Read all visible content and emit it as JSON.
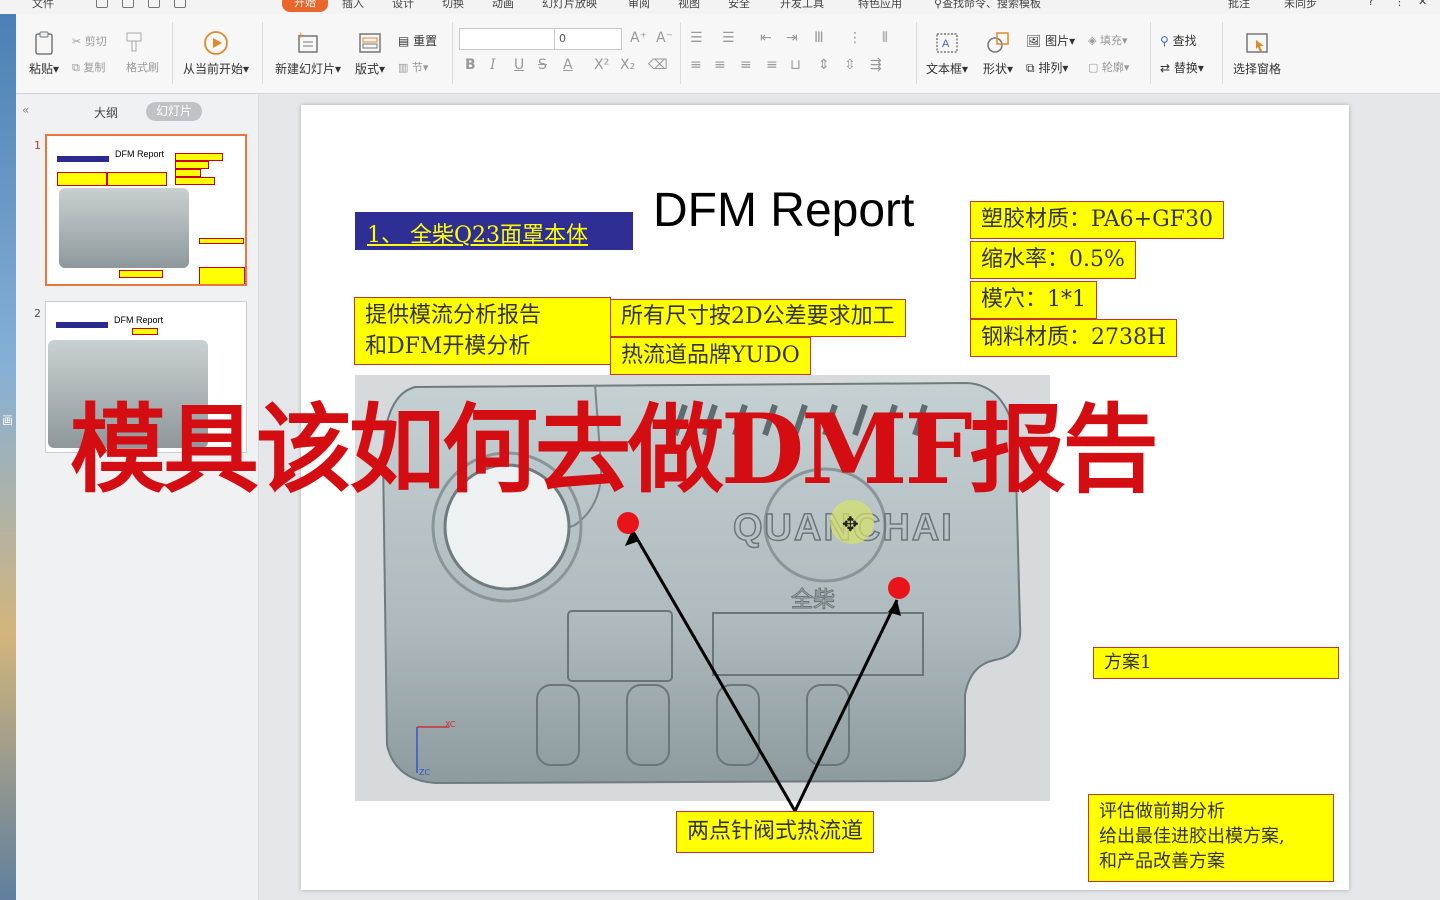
{
  "menubar": {
    "file": "文件",
    "tabs": [
      "开始",
      "插入",
      "设计",
      "切换",
      "动画",
      "幻灯片放映",
      "审阅",
      "视图",
      "安全",
      "开发工具",
      "特色应用"
    ],
    "search": "查找命令、搜索模板",
    "comment": "批注",
    "sync": "未同步"
  },
  "ribbon": {
    "paste": "粘贴",
    "cut": "剪切",
    "copy": "复制",
    "format_painter": "格式刷",
    "from_start": "从当前开始",
    "new_slide": "新建幻灯片",
    "layout": "版式",
    "reset": "重置",
    "section": "节",
    "font_size": "0",
    "textbox": "文本框",
    "shape": "形状",
    "picture": "图片",
    "fill": "填充",
    "arrange": "排列",
    "outline": "轮廓",
    "find": "查找",
    "replace": "替换",
    "select_pane": "选择窗格"
  },
  "leftpane": {
    "tab_outline": "大纲",
    "tab_slides": "幻灯片",
    "thumbs": [
      {
        "num": "1",
        "title": "DFM  Report"
      },
      {
        "num": "2",
        "title": "DFM  Report"
      }
    ]
  },
  "left_edge_char": "画",
  "slide": {
    "title": "DFM  Report",
    "blue_bar": "1、 全柴Q23面罩本体",
    "specs": [
      "塑胶材质：PA6+GF30",
      "缩水率：0.5%",
      "模穴：1*1",
      "钢料材质：2738H"
    ],
    "box_analysis": [
      "提供模流分析报告",
      "和DFM开模分析"
    ],
    "box_tolerance": "所有尺寸按2D公差要求加工",
    "box_hotrunner_brand": "热流道品牌YUDO",
    "plan": "方案1",
    "hot_runner_label": "两点针阀式热流道",
    "eval": [
      "评估做前期分析",
      "给出最佳进胶出模方案,",
      "和产品改善方案"
    ],
    "part_logo": "QUANCHAI",
    "part_logo_cn": "全柴",
    "axis_label": "XC",
    "axis_label_z": "ZC"
  },
  "overlay_caption": "模具该如何去做DMF报告",
  "colors": {
    "accent_tab": "#e9652b",
    "yellow_box": "#ffff00",
    "box_border": "#c0392b",
    "blue_bar": "#2e2e95",
    "overlay_red": "#d40d12"
  }
}
